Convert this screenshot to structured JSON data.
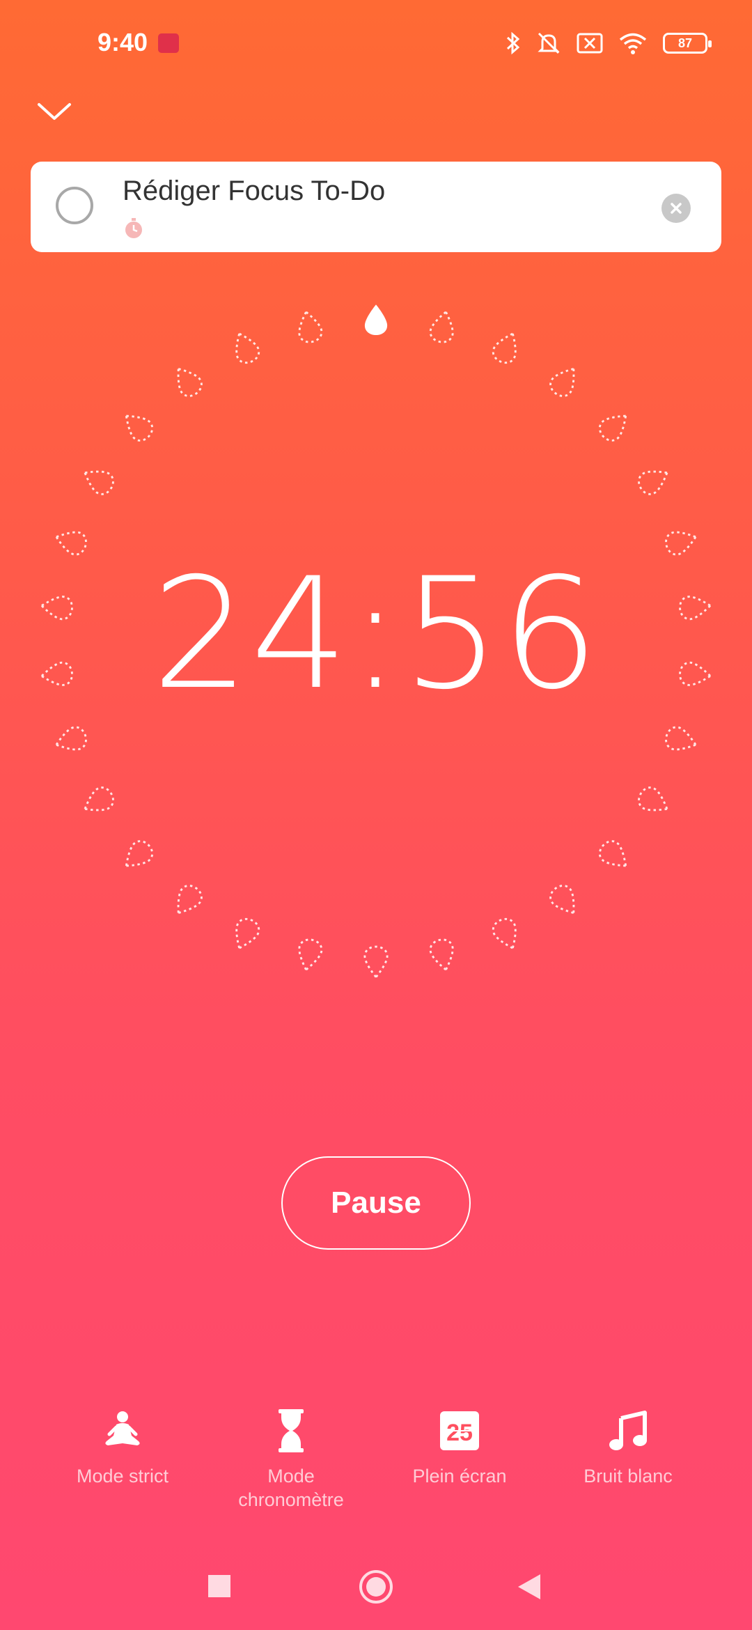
{
  "status_bar": {
    "time": "9:40",
    "battery": "87",
    "icons": [
      "app-notification-icon",
      "bluetooth-icon",
      "silent-icon",
      "no-sim-icon",
      "wifi-icon",
      "battery-icon"
    ]
  },
  "task": {
    "title": "Rédiger Focus To-Do"
  },
  "timer": {
    "display": "24:56",
    "total_marks": 30,
    "completed_marks": 1
  },
  "controls": {
    "pause_label": "Pause"
  },
  "toolbar": {
    "items": [
      {
        "icon": "meditation-icon",
        "label": "Mode strict"
      },
      {
        "icon": "hourglass-icon",
        "label": "Mode\nchronomètre"
      },
      {
        "icon": "calendar-25-icon",
        "label": "Plein écran"
      },
      {
        "icon": "music-note-icon",
        "label": "Bruit blanc"
      }
    ]
  },
  "colors": {
    "gradient_top": "#ff6a34",
    "gradient_bottom": "#ff4870",
    "accent": "#ffffff"
  }
}
